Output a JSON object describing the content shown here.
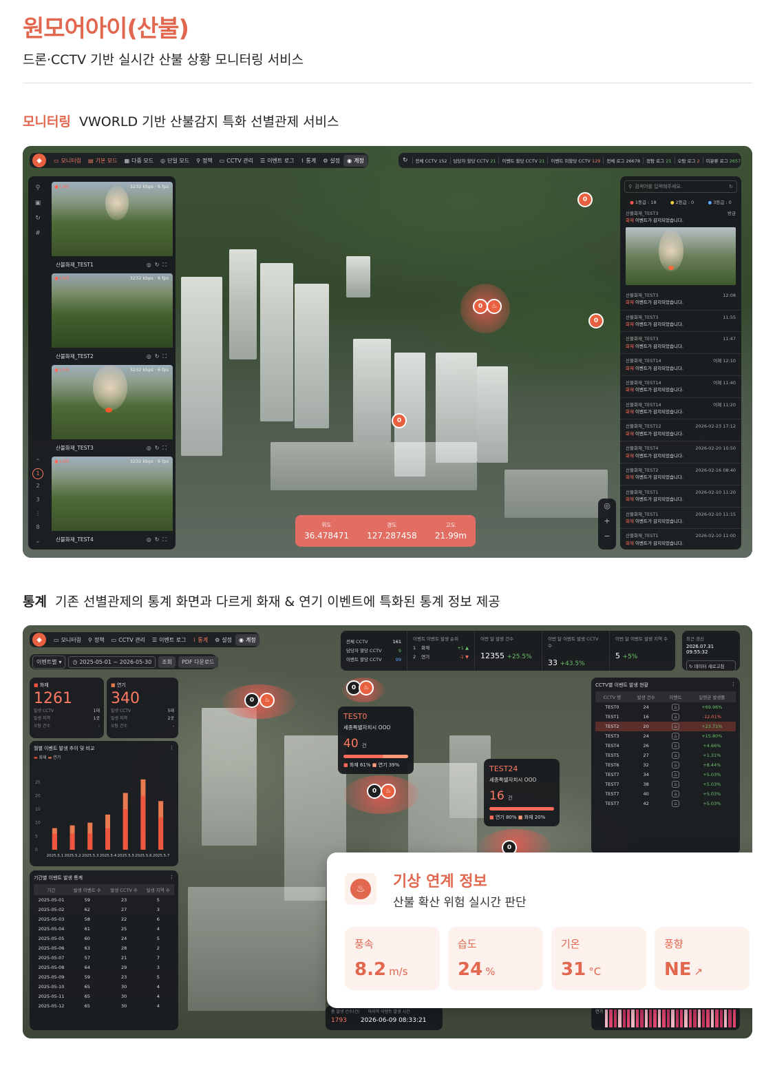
{
  "header": {
    "title": "원모어아이(산불)",
    "subtitle": "드론·CCTV 기반 실시간 산불 상황 모니터링 서비스"
  },
  "section1": {
    "label": "모니터링",
    "desc": "VWORLD 기반 산불감지 특화 선별관제 서비스"
  },
  "section2": {
    "label": "통계",
    "desc": "기존 선별관제의 통계 화면과 다르게 화재 & 연기 이벤트에 특화된 통계 정보 제공"
  },
  "nav1": [
    "모니터링",
    "기본 모드",
    "다중 모드",
    "단일 모드",
    "정책",
    "CCTV 관리",
    "이벤트 로그",
    "통계",
    "설정",
    "계정"
  ],
  "stats1": [
    {
      "label": "전체 CCTV",
      "value": "152",
      "tone": ""
    },
    {
      "label": "담당자 할당 CCTV",
      "value": "21",
      "tone": "g"
    },
    {
      "label": "이벤트 할당 CCTV",
      "value": "21",
      "tone": "g"
    },
    {
      "label": "이벤트 미할당 CCTV",
      "value": "129",
      "tone": "r"
    },
    {
      "label": "전체 로그",
      "value": "26678",
      "tone": ""
    },
    {
      "label": "정탐 로그",
      "value": "21",
      "tone": "g"
    },
    {
      "label": "오탐 로그",
      "value": "2",
      "tone": "r"
    },
    {
      "label": "미분류 로그",
      "value": "2657",
      "tone": "g"
    }
  ],
  "cameras": [
    {
      "name": "산불화재_TEST1",
      "live": "● LIVE",
      "kbps": "3232 kbps · 6 fps"
    },
    {
      "name": "산불화재_TEST2",
      "live": "● LIVE",
      "kbps": "3232 kbps · 6 fps"
    },
    {
      "name": "산불화재_TEST3",
      "live": "● LIVE",
      "kbps": "3232 kbps · 6 fps"
    },
    {
      "name": "산불화재_TEST4",
      "live": "● LIVE",
      "kbps": "3232 kbps · 6 fps"
    }
  ],
  "pager": [
    "1",
    "2",
    "3",
    "8"
  ],
  "coords": {
    "lat_label": "위도",
    "lat": "36.478471",
    "lng_label": "경도",
    "lng": "127.287458",
    "alt_label": "고도",
    "alt": "21.99m"
  },
  "search": {
    "placeholder": "검색어를 입력해주세요.",
    "level1": "1등급 : 18",
    "level2": "2등급 : 0",
    "level3": "3등급 : 0"
  },
  "featured": {
    "name": "산불화재_TEST3",
    "time": "방금",
    "msg_tag": "화재",
    "msg": "이벤트가 감지되었습니다."
  },
  "events": [
    {
      "name": "산불화재_TEST3",
      "time": "12:08"
    },
    {
      "name": "산불화재_TEST3",
      "time": "11:55"
    },
    {
      "name": "산불화재_TEST3",
      "time": "11:47"
    },
    {
      "name": "산불화재_TEST14",
      "time": "어제 12:10"
    },
    {
      "name": "산불화재_TEST14",
      "time": "어제 11:40"
    },
    {
      "name": "산불화재_TEST14",
      "time": "어제 11:20"
    },
    {
      "name": "산불화재_TEST12",
      "time": "2026-02-23 17:12"
    },
    {
      "name": "산불화재_TEST4",
      "time": "2026-02-20 10:50"
    },
    {
      "name": "산불화재_TEST2",
      "time": "2026-02-16 08:40"
    },
    {
      "name": "산불화재_TEST1",
      "time": "2026-02-10 11:20"
    },
    {
      "name": "산불화재_TEST1",
      "time": "2026-02-10 11:15"
    },
    {
      "name": "산불화재_TEST1",
      "time": "2026-02-10 11:00"
    }
  ],
  "event_msg": {
    "tag": "화재",
    "text": "이벤트가 감지되었습니다."
  },
  "nav2": [
    "모니터링",
    "정책",
    "CCTV 관리",
    "이벤트 로그",
    "통계",
    "설정",
    "계정"
  ],
  "filters": {
    "type": "이벤트별",
    "range": "2025-05-01 ~ 2026-05-30",
    "search": "조회",
    "pdf": "PDF 다운로드"
  },
  "topstats": {
    "cctv": [
      {
        "k": "전체 CCTV",
        "v": "161"
      },
      {
        "k": "담당자 할당 CCTV",
        "v": "9"
      },
      {
        "k": "이벤트 할당 CCTV",
        "v": "99"
      }
    ],
    "rank_title": "이벤트 이벤트 발생 순위",
    "rank": [
      {
        "n": "1",
        "k": "화재",
        "d": "+1 ▲"
      },
      {
        "n": "2",
        "k": "연기",
        "d": "-1 ▼"
      }
    ],
    "m1": {
      "k": "이번 달 발생 건수",
      "v": "12355",
      "d": "+25.5%"
    },
    "m2": {
      "k": "이번 달 이벤트 발생 CCTV 수",
      "v": "33",
      "d": "+43.5%"
    },
    "m3": {
      "k": "이번 달 이벤트 발생 지역 수",
      "v": "5",
      "d": "+5%"
    },
    "update": {
      "k": "최근 갱신",
      "v": "2026.07.31 09:55:32",
      "btn": "데이터 새로고침"
    }
  },
  "fire": {
    "k": "화재",
    "v": "1261",
    "rows": [
      [
        "발생 CCTV",
        "1대"
      ],
      [
        "발생 지역",
        "1곳"
      ],
      [
        "오탐 건수",
        "-"
      ]
    ]
  },
  "smoke": {
    "k": "연기",
    "v": "340",
    "rows": [
      [
        "발생 CCTV",
        "5대"
      ],
      [
        "발생 지역",
        "2곳"
      ],
      [
        "오탐 건수",
        "-"
      ]
    ]
  },
  "chart_data": {
    "type": "bar",
    "title": "월별 이벤트 발생 추이 및 비교",
    "categories": [
      "2025.5.1",
      "2025.5.2",
      "2025.5.3",
      "2025.5.4",
      "2025.5.5",
      "2025.5.6",
      "2025.5.7"
    ],
    "series": [
      {
        "name": "화재",
        "values": [
          8,
          9,
          10,
          13,
          21,
          26,
          18
        ]
      },
      {
        "name": "연기",
        "values": [
          6,
          6,
          6,
          8,
          15,
          20,
          12
        ]
      }
    ],
    "yticks": [
      "25",
      "20",
      "15",
      "10",
      "5",
      "0"
    ],
    "ylim": [
      0,
      28
    ]
  },
  "colors": {
    "fire": "#f0503c",
    "smoke": "#e87a52",
    "accent": "#e2674f"
  },
  "period": {
    "title": "기간별 이벤트 발생 통계",
    "headers": [
      "기간",
      "발생 이벤트 수",
      "발생 CCTV 수",
      "발생 지역 수"
    ],
    "rows": [
      [
        "2025-05-01",
        "59",
        "23",
        "5"
      ],
      [
        "2025-05-02",
        "62",
        "27",
        "3"
      ],
      [
        "2025-05-03",
        "58",
        "22",
        "6"
      ],
      [
        "2025-05-04",
        "61",
        "25",
        "4"
      ],
      [
        "2025-05-05",
        "60",
        "24",
        "5"
      ],
      [
        "2025-05-06",
        "63",
        "28",
        "2"
      ],
      [
        "2025-05-07",
        "57",
        "21",
        "7"
      ],
      [
        "2025-05-08",
        "64",
        "29",
        "3"
      ],
      [
        "2025-05-09",
        "59",
        "23",
        "5"
      ],
      [
        "2025-05-10",
        "65",
        "30",
        "4"
      ],
      [
        "2025-05-11",
        "65",
        "30",
        "4"
      ],
      [
        "2025-05-12",
        "65",
        "30",
        "4"
      ]
    ]
  },
  "cctv_table": {
    "title": "CCTV별 이벤트 발생 현황",
    "headers": [
      "CCTV 명",
      "발생 건수",
      "이벤트",
      "일평균 발생률"
    ],
    "rows": [
      [
        "TEST0",
        "24",
        "+69.96%"
      ],
      [
        "TEST1",
        "16",
        "-12.01%"
      ],
      [
        "TEST2",
        "20",
        "+23.71%"
      ],
      [
        "TEST3",
        "24",
        "+15.80%"
      ],
      [
        "TEST4",
        "26",
        "+4.66%"
      ],
      [
        "TEST5",
        "27",
        "+1.31%"
      ],
      [
        "TEST6",
        "32",
        "+8.44%"
      ],
      [
        "TEST7",
        "34",
        "+5.03%"
      ],
      [
        "TEST7",
        "38",
        "+5.03%"
      ],
      [
        "TEST7",
        "40",
        "+5.03%"
      ],
      [
        "TEST7",
        "42",
        "+5.03%"
      ]
    ]
  },
  "popup1": {
    "title": "TEST0",
    "loc": "세종특별자치시 OOO",
    "count": "40",
    "unit": "건",
    "a": "화재 61%",
    "b": "연기 39%"
  },
  "popup2": {
    "title": "TEST24",
    "loc": "세종특별자치시 OOO",
    "count": "16",
    "unit": "건",
    "a": "연기 80%",
    "b": "화재 20%"
  },
  "weather": {
    "title": "기상 연계 정보",
    "sub": "산불 확산 위험 실시간 판단",
    "wind": {
      "k": "풍속",
      "v": "8.2",
      "u": "m/s"
    },
    "hum": {
      "k": "습도",
      "v": "24",
      "u": "%"
    },
    "temp": {
      "k": "기온",
      "v": "31",
      "u": "°C"
    },
    "dir": {
      "k": "풍향",
      "v": "NE",
      "u": "↗"
    }
  },
  "footer": {
    "k1": "총 발생 건수(건)",
    "v1": "1793",
    "k2": "마지막 이벤트 발생 시간",
    "v2": "2026-06-09 08:33:21",
    "k3": "연기"
  }
}
